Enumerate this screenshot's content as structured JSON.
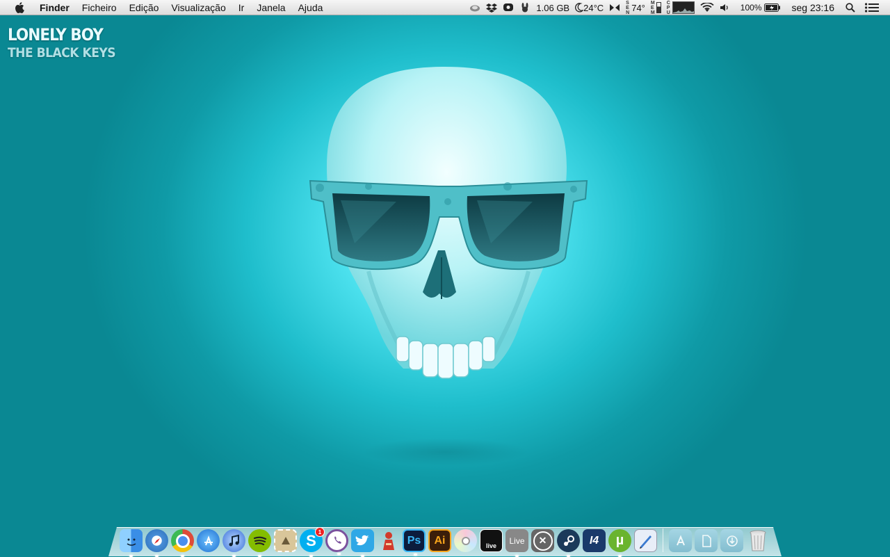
{
  "menubar": {
    "app_name": "Finder",
    "menus": [
      "Ficheiro",
      "Edição",
      "Visualização",
      "Ir",
      "Janela",
      "Ajuda"
    ],
    "status": {
      "memory": "1.06 GB",
      "temperature": "24°C",
      "cpu_temp": "74°",
      "battery": "100%",
      "clock": "seg 23:16"
    }
  },
  "now_playing": {
    "song": "LONELY BOY",
    "artist": "THE BLACK KEYS"
  },
  "dock": {
    "items": [
      {
        "name": "finder",
        "label": "",
        "color": "#3a8ee6"
      },
      {
        "name": "safari",
        "label": "",
        "color": "#4a8fd8"
      },
      {
        "name": "chrome",
        "label": "",
        "color": "#dd4b39"
      },
      {
        "name": "app-store",
        "label": "",
        "color": "#2a8fe8"
      },
      {
        "name": "itunes",
        "label": "",
        "color": "#3a6fd8"
      },
      {
        "name": "spotify",
        "label": "",
        "color": "#84bd00"
      },
      {
        "name": "mail-stamp",
        "label": "",
        "color": "#c8b48a"
      },
      {
        "name": "skype",
        "label": "S",
        "color": "#00aff0",
        "badge": "1"
      },
      {
        "name": "viber",
        "label": "",
        "color": "#7b519d"
      },
      {
        "name": "twitter",
        "label": "",
        "color": "#2fa8e6"
      },
      {
        "name": "red-figure",
        "label": "",
        "color": "#d23b2b"
      },
      {
        "name": "photoshop",
        "label": "Ps",
        "color": "#0c1c3d",
        "fg": "#38b6f5"
      },
      {
        "name": "illustrator",
        "label": "Ai",
        "color": "#3b1e0a",
        "fg": "#f7a51c"
      },
      {
        "name": "dvd-player",
        "label": "",
        "color": "#dcdcdc"
      },
      {
        "name": "ableton-live-a",
        "label": "live",
        "color": "#111111"
      },
      {
        "name": "ableton-live",
        "label": "Live",
        "color": "#888888"
      },
      {
        "name": "cross-app",
        "label": "",
        "color": "#777777"
      },
      {
        "name": "steam",
        "label": "",
        "color": "#1b3a5a"
      },
      {
        "name": "i4",
        "label": "I4",
        "color": "#1a3a6a"
      },
      {
        "name": "utorrent",
        "label": "",
        "color": "#6ab42f"
      },
      {
        "name": "pages-pen",
        "label": "",
        "color": "#3a7ad0"
      }
    ],
    "stacks": [
      {
        "name": "applications-stack"
      },
      {
        "name": "documents-stack"
      },
      {
        "name": "downloads-stack"
      }
    ]
  }
}
